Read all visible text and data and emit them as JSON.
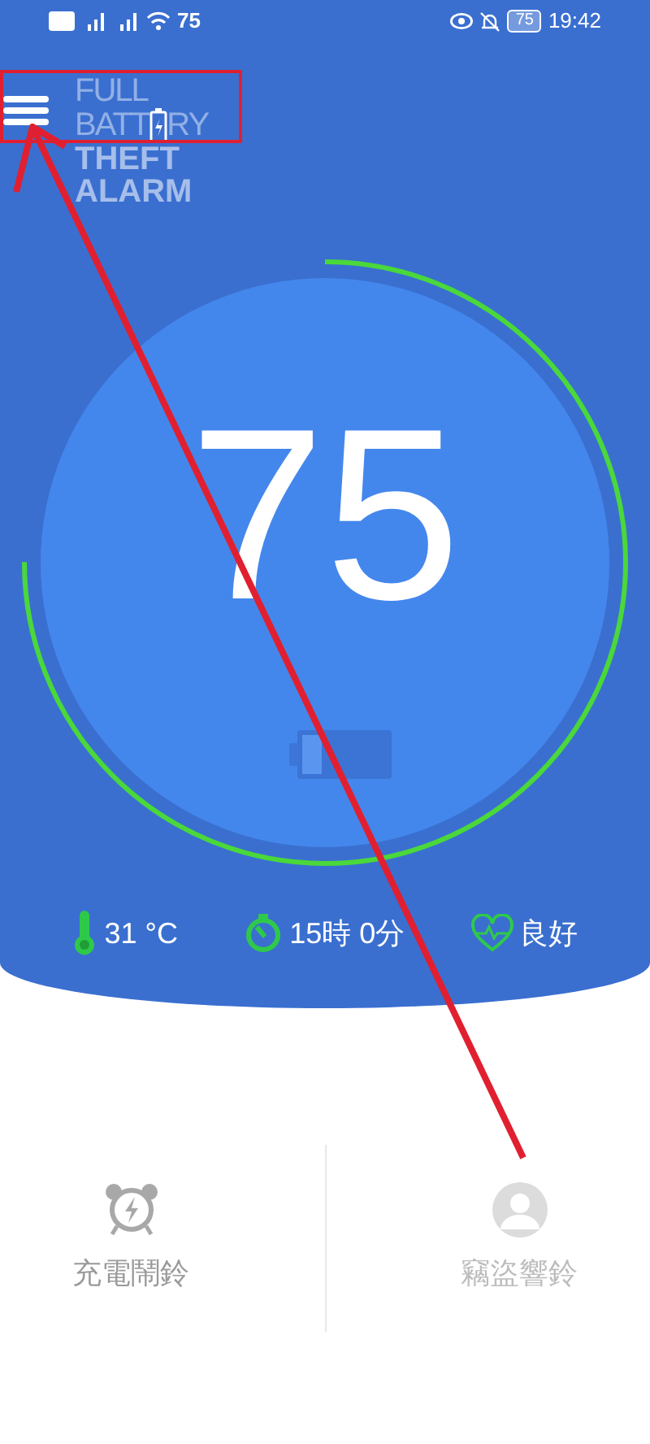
{
  "status_bar": {
    "network": "75",
    "battery": "75",
    "time": "19:42"
  },
  "header": {
    "logo": {
      "line1": "FULL",
      "line2_start": "BATT",
      "line2_end": "RY",
      "line3": "THEFT",
      "line4": "ALARM"
    }
  },
  "gauge": {
    "value": "75",
    "level": 0.75
  },
  "stats": [
    {
      "kind": "temperature",
      "text": "31 °C"
    },
    {
      "kind": "timer",
      "text": "15時 0分"
    },
    {
      "kind": "health",
      "text": "良好"
    }
  ],
  "actions": [
    {
      "kind": "charge-alarm",
      "label": "充電鬧鈴",
      "disabled": false
    },
    {
      "kind": "theft-alarm",
      "label": "竊盜響鈴",
      "disabled": true
    }
  ],
  "annotation": {
    "highlight": true,
    "arrow": true
  }
}
